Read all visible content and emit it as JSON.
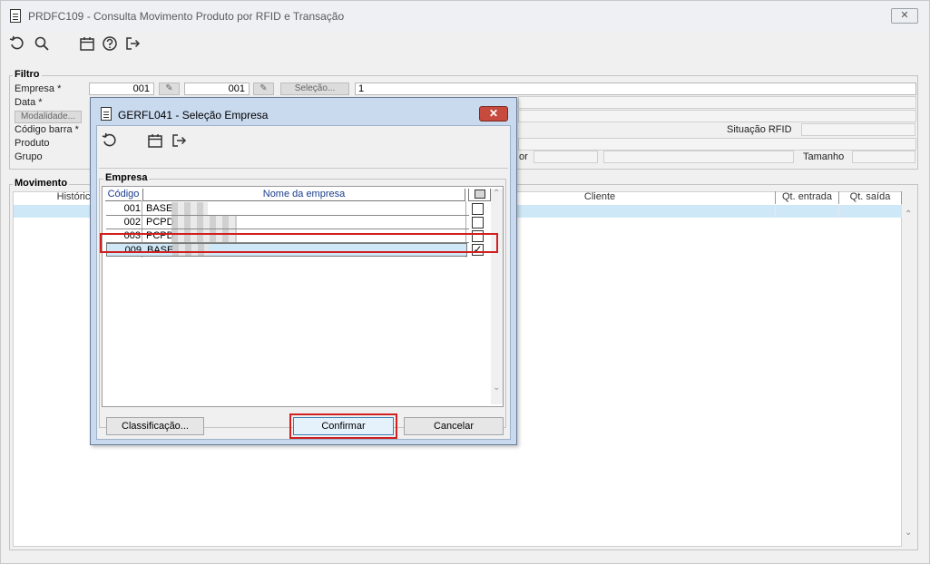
{
  "window": {
    "title": "PRDFC109 - Consulta Movimento Produto por RFID e Transação",
    "close_glyph": "✕"
  },
  "toolbar": {
    "icons": [
      "refresh-icon",
      "search-icon",
      "calendar-icon",
      "help-icon",
      "exit-icon"
    ]
  },
  "filtro": {
    "title": "Filtro",
    "empresa_label": "Empresa *",
    "empresa_from": "001",
    "empresa_to": "001",
    "selecao_label": "Seleção...",
    "empresa_value": "1",
    "data_label": "Data *",
    "modalidade_label": "Modalidade...",
    "codigo_barra_label": "Código barra *",
    "produto_label": "Produto",
    "grupo_label": "Grupo",
    "situacao_label": "Situação RFID",
    "tamanho_label": "Tamanho",
    "cor_label_fragment": "or"
  },
  "movimento": {
    "title": "Movimento",
    "columns": {
      "historico": "Históric",
      "cliente": "Cliente",
      "qt_entrada": "Qt. entrada",
      "qt_saida": "Qt. saída"
    }
  },
  "dialog": {
    "title": "GERFL041 - Seleção Empresa",
    "close_glyph": "✕",
    "group_title": "Empresa",
    "col_codigo": "Código",
    "col_nome": "Nome da empresa",
    "rows": [
      {
        "codigo": "001",
        "nome": "BASE",
        "checked": false
      },
      {
        "codigo": "002",
        "nome": "PCPD",
        "checked": false
      },
      {
        "codigo": "003",
        "nome": "PCPD",
        "checked": false
      },
      {
        "codigo": "009",
        "nome": "BASE",
        "checked": true
      }
    ],
    "check_glyph": "✓",
    "btn_classificacao": "Classificação...",
    "btn_confirmar": "Confirmar",
    "btn_cancelar": "Cancelar"
  }
}
